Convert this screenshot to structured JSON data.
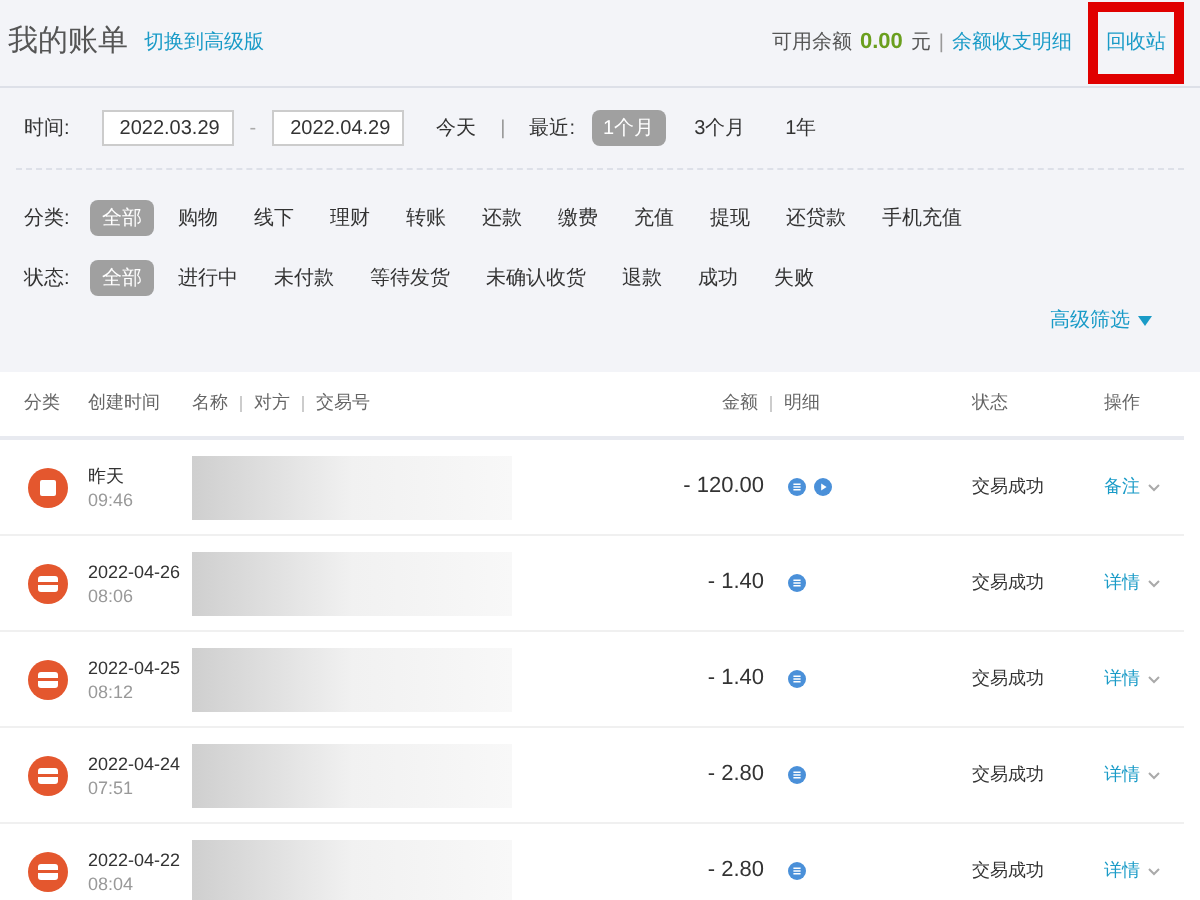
{
  "header": {
    "title": "我的账单",
    "switch_link": "切换到高级版",
    "balance_label": "可用余额",
    "balance": "0.00",
    "currency": "元",
    "separator": "|",
    "statement_link": "余额收支明细",
    "recycle_link": "回收站",
    "recycle_highlighted": true
  },
  "time_filter": {
    "label": "时间:",
    "start": "2022.03.29",
    "dash": "-",
    "end": "2022.04.29",
    "today": "今天",
    "separator": "|",
    "recent_label": "最近:",
    "ranges": [
      {
        "label": "1个月",
        "selected": true
      },
      {
        "label": "3个月",
        "selected": false
      },
      {
        "label": "1年",
        "selected": false
      }
    ]
  },
  "category_filter": {
    "label": "分类:",
    "options": [
      {
        "label": "全部",
        "selected": true
      },
      {
        "label": "购物",
        "selected": false
      },
      {
        "label": "线下",
        "selected": false
      },
      {
        "label": "理财",
        "selected": false
      },
      {
        "label": "转账",
        "selected": false
      },
      {
        "label": "还款",
        "selected": false
      },
      {
        "label": "缴费",
        "selected": false
      },
      {
        "label": "充值",
        "selected": false
      },
      {
        "label": "提现",
        "selected": false
      },
      {
        "label": "还贷款",
        "selected": false
      },
      {
        "label": "手机充值",
        "selected": false
      }
    ]
  },
  "status_filter": {
    "label": "状态:",
    "options": [
      {
        "label": "全部",
        "selected": true
      },
      {
        "label": "进行中",
        "selected": false
      },
      {
        "label": "未付款",
        "selected": false
      },
      {
        "label": "等待发货",
        "selected": false
      },
      {
        "label": "未确认收货",
        "selected": false
      },
      {
        "label": "退款",
        "selected": false
      },
      {
        "label": "成功",
        "selected": false
      },
      {
        "label": "失败",
        "selected": false
      }
    ]
  },
  "advanced_filter": "高级筛选",
  "table": {
    "columns": {
      "category": "分类",
      "created": "创建时间",
      "name": "名称",
      "counterparty": "对方",
      "trade_no": "交易号",
      "amount": "金额",
      "detail": "明细",
      "status": "状态",
      "action": "操作"
    },
    "rows": [
      {
        "kind": "bag",
        "date": "昨天",
        "time": "09:46",
        "amount": "- 120.00",
        "detail_icons": [
          {
            "kind": "list"
          },
          {
            "kind": "play"
          }
        ],
        "status": "交易成功",
        "action": "备注"
      },
      {
        "kind": "card",
        "date": "2022-04-26",
        "time": "08:06",
        "amount": "- 1.40",
        "detail_icons": [
          {
            "kind": "list"
          }
        ],
        "status": "交易成功",
        "action": "详情"
      },
      {
        "kind": "card",
        "date": "2022-04-25",
        "time": "08:12",
        "amount": "- 1.40",
        "detail_icons": [
          {
            "kind": "list"
          }
        ],
        "status": "交易成功",
        "action": "详情"
      },
      {
        "kind": "card",
        "date": "2022-04-24",
        "time": "07:51",
        "amount": "- 2.80",
        "detail_icons": [
          {
            "kind": "list"
          }
        ],
        "status": "交易成功",
        "action": "详情"
      },
      {
        "kind": "card",
        "date": "2022-04-22",
        "time": "08:04",
        "amount": "- 2.80",
        "detail_icons": [
          {
            "kind": "list"
          }
        ],
        "status": "交易成功",
        "action": "详情"
      }
    ]
  }
}
